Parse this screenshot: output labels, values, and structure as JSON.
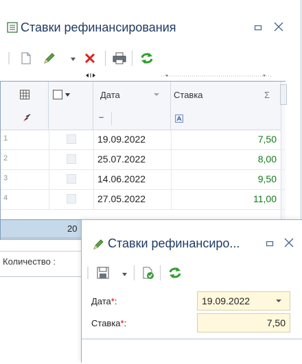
{
  "main_window": {
    "title": "Ставки рефинансирования",
    "toolbar": {
      "icons": [
        "new-icon",
        "edit-icon",
        "dropdown-icon",
        "delete-icon",
        "print-icon",
        "refresh-icon"
      ]
    },
    "grid": {
      "columns": [
        {
          "key": "date",
          "label": "Дата"
        },
        {
          "key": "rate",
          "label": "Ставка"
        }
      ],
      "sum_symbol": "Σ",
      "filter_date": "–",
      "rows": [
        {
          "num": "1",
          "date": "19.09.2022",
          "rate": "7,50"
        },
        {
          "num": "2",
          "date": "25.07.2022",
          "rate": "8,00"
        },
        {
          "num": "3",
          "date": "14.06.2022",
          "rate": "9,50"
        },
        {
          "num": "4",
          "date": "27.05.2022",
          "rate": "11,00"
        }
      ],
      "footer_count": "20"
    },
    "status_label": "Количество :"
  },
  "dialog": {
    "title": "Ставки рефинансиро...",
    "fields": {
      "date": {
        "label": "Дата",
        "required_mark": "*",
        "colon": ":",
        "value": "19.09.2022"
      },
      "rate": {
        "label": "Ставка",
        "required_mark": "*",
        "colon": ":",
        "value": "7,50"
      }
    }
  },
  "colors": {
    "title_text": "#1f3b63",
    "rate_text": "#0f7a18",
    "required_field_bg": "#fff8dc",
    "footer_highlight": "#c5d9ea",
    "delete_red": "#e0201b",
    "refresh_green": "#2f9e2b"
  }
}
